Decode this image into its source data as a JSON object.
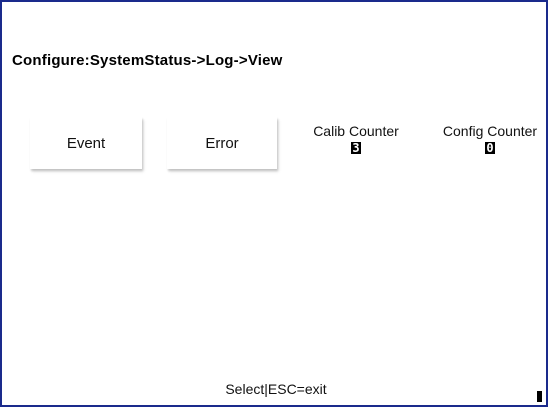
{
  "header": {
    "title": "Configure:SystemStatus->Log->View"
  },
  "buttons": {
    "event_label": "Event",
    "error_label": "Error"
  },
  "counters": {
    "calib": {
      "label": "Calib Counter",
      "value": "3"
    },
    "config": {
      "label": "Config Counter",
      "value": "0"
    }
  },
  "footer": {
    "hint": "Select|ESC=exit"
  },
  "colors": {
    "frame_border": "#1a2a8c",
    "background": "#ffffff"
  }
}
